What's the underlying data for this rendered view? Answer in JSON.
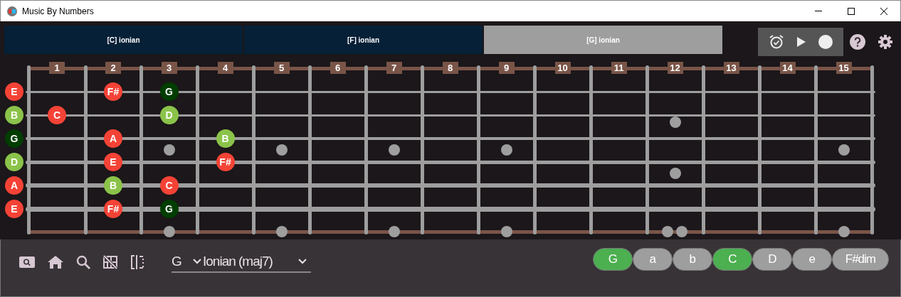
{
  "window": {
    "title": "Music By Numbers"
  },
  "scale_tabs": [
    {
      "label": "[C] ionian",
      "selected": false
    },
    {
      "label": "[F] ionian",
      "selected": false
    },
    {
      "label": "[G] ionian",
      "selected": true
    }
  ],
  "fret_numbers": [
    "1",
    "2",
    "3",
    "4",
    "5",
    "6",
    "7",
    "8",
    "9",
    "10",
    "11",
    "12",
    "13",
    "14",
    "15"
  ],
  "strings": [
    {
      "cells": [
        {
          "kind": "note",
          "label": "E",
          "color": "#f44336"
        },
        {
          "kind": "empty"
        },
        {
          "kind": "note",
          "label": "F#",
          "color": "#f44336"
        },
        {
          "kind": "note",
          "label": "G",
          "color": "#003d00"
        }
      ]
    },
    {
      "cells": [
        {
          "kind": "note",
          "label": "B",
          "color": "#8bc34a"
        },
        {
          "kind": "note",
          "label": "C",
          "color": "#f44336"
        },
        {
          "kind": "empty"
        },
        {
          "kind": "note",
          "label": "D",
          "color": "#8bc34a"
        }
      ]
    },
    {
      "cells": [
        {
          "kind": "note",
          "label": "G",
          "color": "#003d00"
        },
        {
          "kind": "empty"
        },
        {
          "kind": "note",
          "label": "A",
          "color": "#f44336"
        },
        {
          "kind": "empty"
        },
        {
          "kind": "note",
          "label": "B",
          "color": "#8bc34a"
        }
      ]
    },
    {
      "cells": [
        {
          "kind": "note",
          "label": "D",
          "color": "#8bc34a"
        },
        {
          "kind": "empty"
        },
        {
          "kind": "note",
          "label": "E",
          "color": "#f44336"
        },
        {
          "kind": "empty"
        },
        {
          "kind": "note",
          "label": "F#",
          "color": "#f44336"
        }
      ]
    },
    {
      "cells": [
        {
          "kind": "note",
          "label": "A",
          "color": "#f44336"
        },
        {
          "kind": "empty"
        },
        {
          "kind": "note",
          "label": "B",
          "color": "#8bc34a"
        },
        {
          "kind": "note",
          "label": "C",
          "color": "#f44336"
        }
      ]
    },
    {
      "cells": [
        {
          "kind": "note",
          "label": "E",
          "color": "#f44336"
        },
        {
          "kind": "empty"
        },
        {
          "kind": "note",
          "label": "F#",
          "color": "#f44336"
        },
        {
          "kind": "note",
          "label": "G",
          "color": "#003d00"
        }
      ]
    }
  ],
  "key_select": {
    "value": "G"
  },
  "mode_select": {
    "value": "Ionian (maj7)"
  },
  "chords": [
    {
      "label": "G",
      "selected": true
    },
    {
      "label": "a",
      "selected": false
    },
    {
      "label": "b",
      "selected": false
    },
    {
      "label": "C",
      "selected": true
    },
    {
      "label": "D",
      "selected": false
    },
    {
      "label": "e",
      "selected": false
    },
    {
      "label": "F#dim",
      "selected": false
    }
  ]
}
